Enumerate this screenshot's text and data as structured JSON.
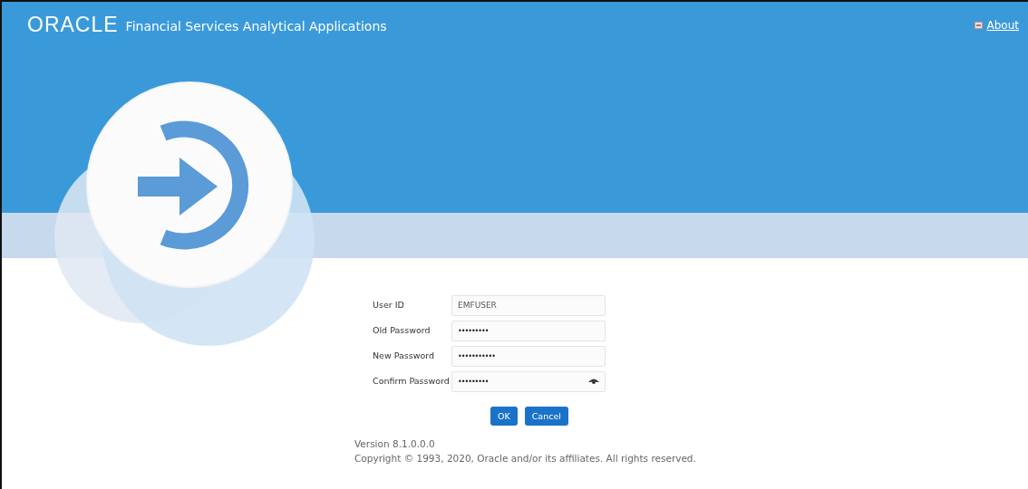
{
  "header": {
    "logo": "ORACLE",
    "title": "Financial Services Analytical Applications",
    "about_link": "About"
  },
  "form": {
    "fields": [
      {
        "label": "User ID",
        "value": "EMFUSER",
        "kind": "text"
      },
      {
        "label": "Old Password",
        "value": "•••••••••",
        "kind": "text"
      },
      {
        "label": "New Password",
        "value": "•••••••••••",
        "kind": "text"
      },
      {
        "label": "Confirm Password",
        "value": "•••••••••",
        "kind": "reveal"
      }
    ],
    "buttons": [
      "OK",
      "Cancel"
    ]
  },
  "footer": {
    "version": "Version 8.1.0.0.0",
    "copyright": "Copyright © 1993, 2020, Oracle and/or its affiliates. All rights reserved."
  }
}
